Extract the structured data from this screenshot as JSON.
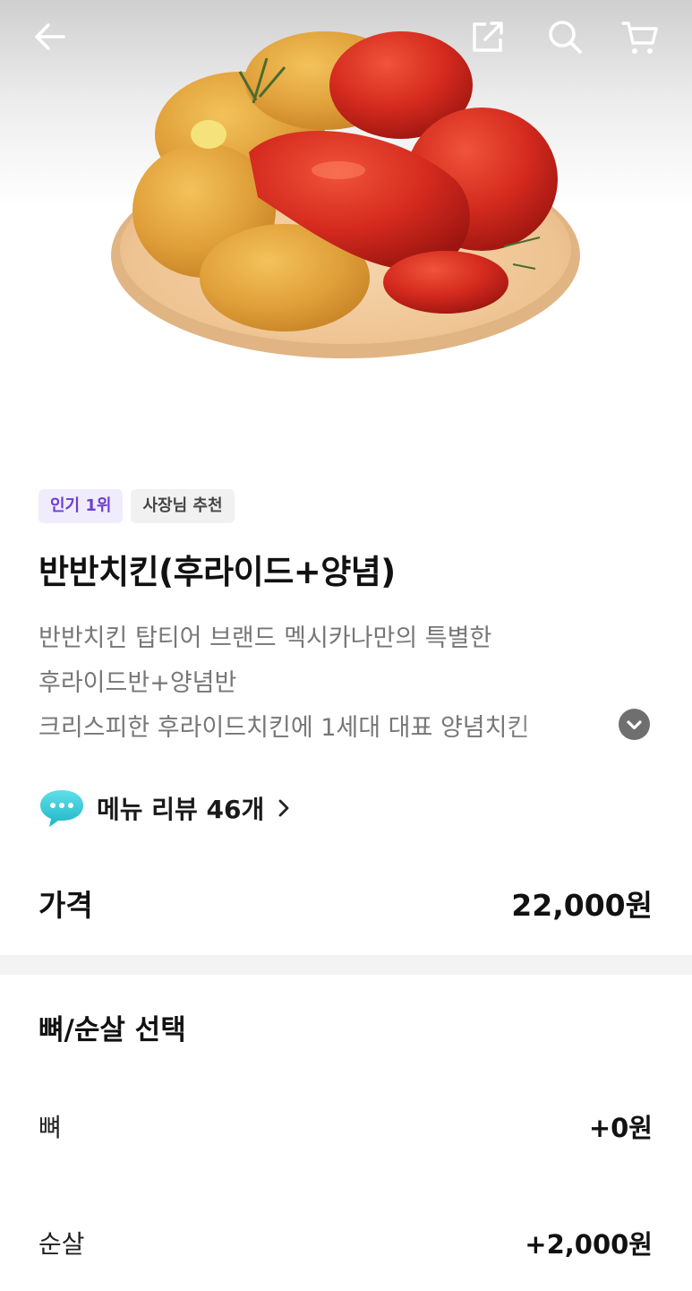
{
  "badges": {
    "popular": "인기 1위",
    "owner_pick": "사장님 추천"
  },
  "menu": {
    "title": "반반치킨(후라이드+양념)",
    "description_lines": [
      "반반치킨 탑티어 브랜드 멕시카나만의 특별한",
      "후라이드반+양념반",
      "크리스피한 후라이드치킨에 1세대 대표 양념치킨"
    ]
  },
  "reviews": {
    "label": "메뉴 리뷰 46개"
  },
  "price": {
    "label": "가격",
    "value": "22,000원"
  },
  "options": {
    "title": "뼈/순살 선택",
    "items": [
      {
        "name": "뼈",
        "price": "+0원"
      },
      {
        "name": "순살",
        "price": "+2,000원"
      }
    ]
  },
  "icons": {
    "back": "arrow-left-icon",
    "share": "share-icon",
    "search": "search-icon",
    "cart": "cart-icon",
    "expand": "chevron-down-icon",
    "review": "speech-bubble-icon",
    "review_chevron": "chevron-right-icon"
  },
  "colors": {
    "popular_badge_bg": "#f1ecfb",
    "popular_badge_text": "#6a3fd6",
    "review_bubble": "#2fc4d6"
  }
}
